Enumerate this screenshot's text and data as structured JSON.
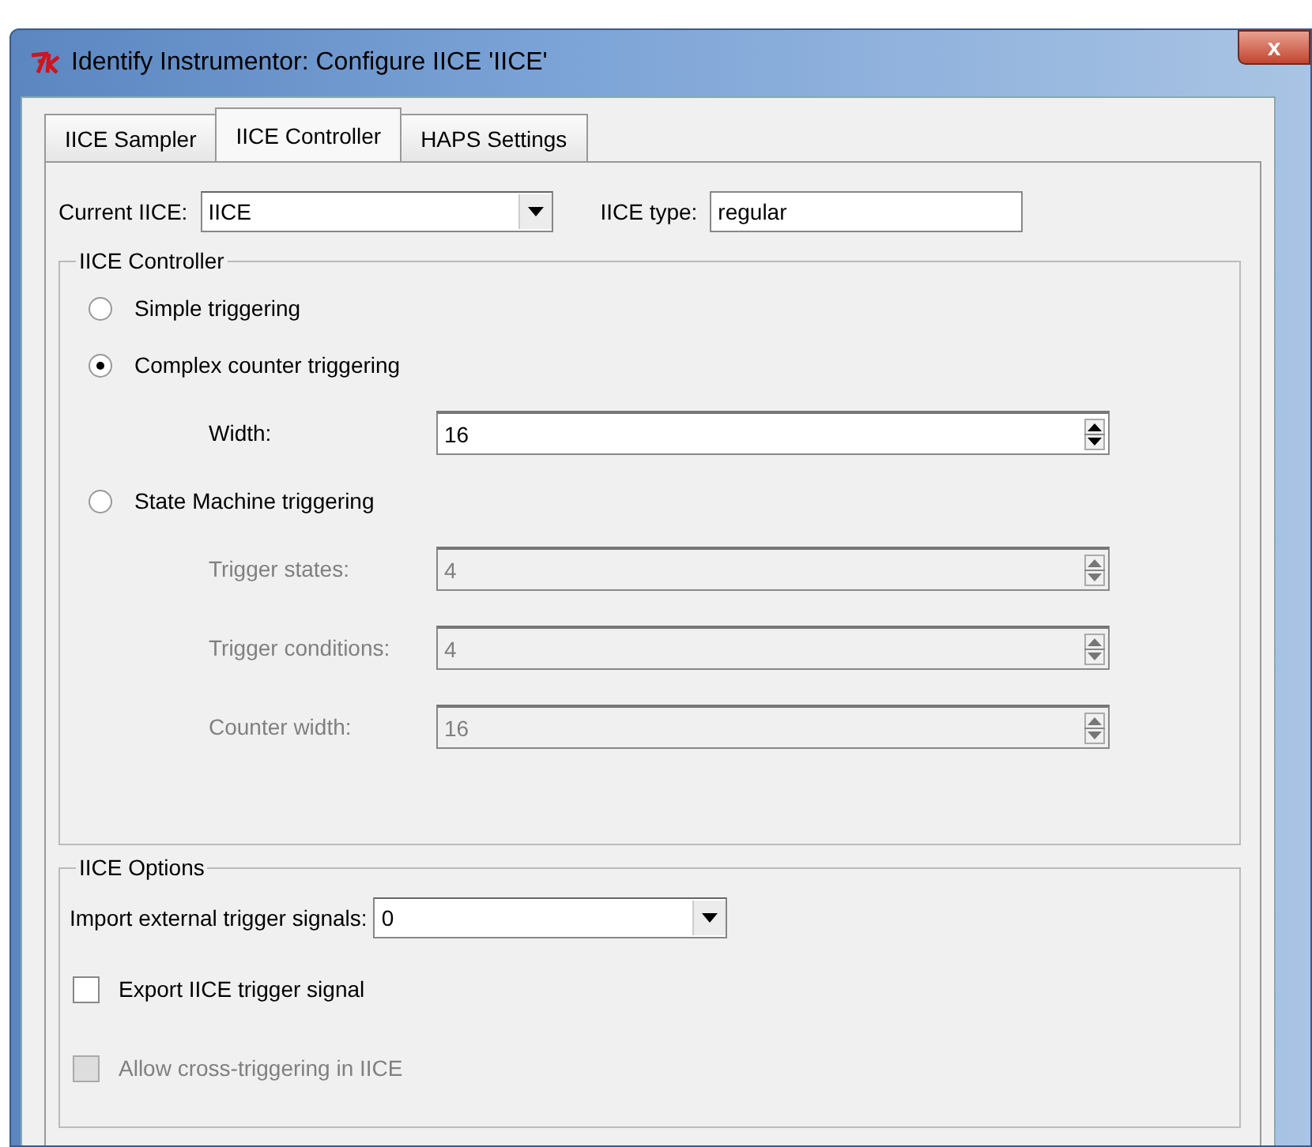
{
  "window": {
    "title": "Identify Instrumentor: Configure IICE 'IICE'",
    "close": "x"
  },
  "tabs": [
    {
      "label": "IICE Sampler",
      "selected": false
    },
    {
      "label": "IICE Controller",
      "selected": true
    },
    {
      "label": "HAPS Settings",
      "selected": false
    }
  ],
  "current_iice": {
    "label": "Current IICE:",
    "value": "IICE"
  },
  "iice_type": {
    "label": "IICE type:",
    "value": "regular"
  },
  "controller": {
    "legend": "IICE Controller",
    "modes": [
      {
        "label": "Simple triggering",
        "selected": false
      },
      {
        "label": "Complex counter triggering",
        "selected": true,
        "params": [
          {
            "label": "Width:",
            "value": "16",
            "disabled": false
          }
        ]
      },
      {
        "label": "State Machine triggering",
        "selected": false,
        "params": [
          {
            "label": "Trigger states:",
            "value": "4",
            "disabled": true
          },
          {
            "label": "Trigger conditions:",
            "value": "4",
            "disabled": true
          },
          {
            "label": "Counter width:",
            "value": "16",
            "disabled": true
          }
        ]
      }
    ]
  },
  "options": {
    "legend": "IICE Options",
    "import": {
      "label": "Import external trigger signals:",
      "value": "0"
    },
    "checkboxes": [
      {
        "label": "Export IICE trigger signal",
        "checked": false,
        "disabled": false
      },
      {
        "label": "Allow cross-triggering in IICE",
        "checked": false,
        "disabled": true
      }
    ]
  }
}
